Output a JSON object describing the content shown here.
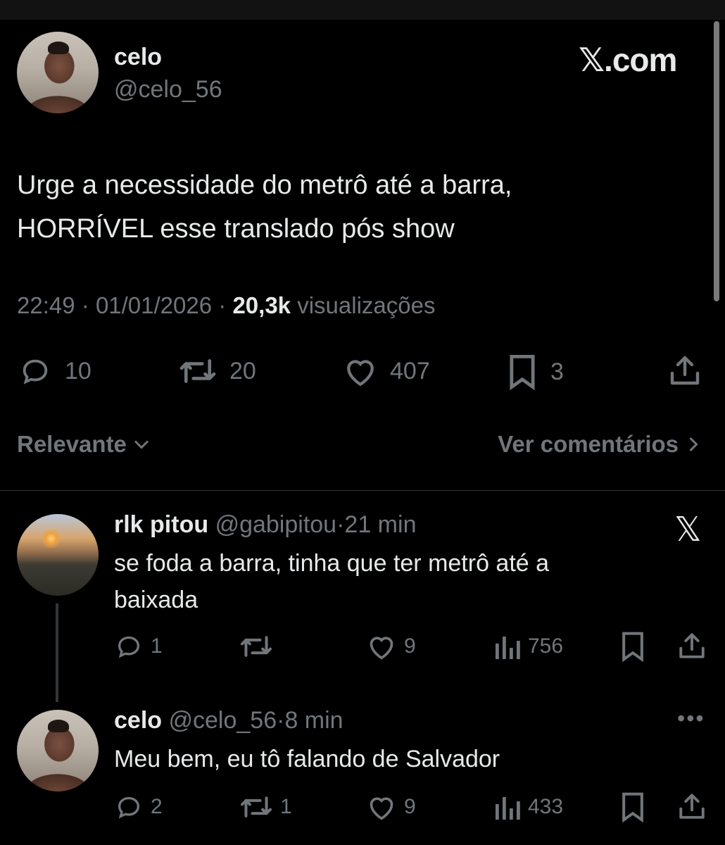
{
  "main_tweet": {
    "author_name": "celo",
    "author_handle": "@celo_56",
    "brand": "𝕏.com",
    "text_line1": "Urge a necessidade do metrô até a barra,",
    "text_line2": "HORRÍVEL esse translado pós show",
    "time": "22:49",
    "date": "01/01/2026",
    "views": "20,3k",
    "views_label": "visualizações",
    "dot": "·",
    "replies": "10",
    "retweets": "20",
    "likes": "407",
    "bookmarks": "3"
  },
  "sort": {
    "relevant_label": "Relevante",
    "view_comments_label": "Ver comentários"
  },
  "replies": [
    {
      "name": "rlk pitou",
      "handle": "@gabipitou",
      "time": "21 min",
      "text_line1": "se foda a barra, tinha que ter metrô até a",
      "text_line2": "baixada",
      "replies": "1",
      "retweets": "",
      "likes": "9",
      "views": "756"
    },
    {
      "name": "celo",
      "handle": "@celo_56",
      "time": "8 min",
      "text_line1": "Meu bem, eu tô falando de Salvador",
      "replies": "2",
      "retweets": "1",
      "likes": "9",
      "views": "433"
    }
  ],
  "colors": {
    "background": "#000000",
    "text_primary": "#e7e9ea",
    "text_secondary": "#71767b",
    "divider": "#2f3336"
  }
}
